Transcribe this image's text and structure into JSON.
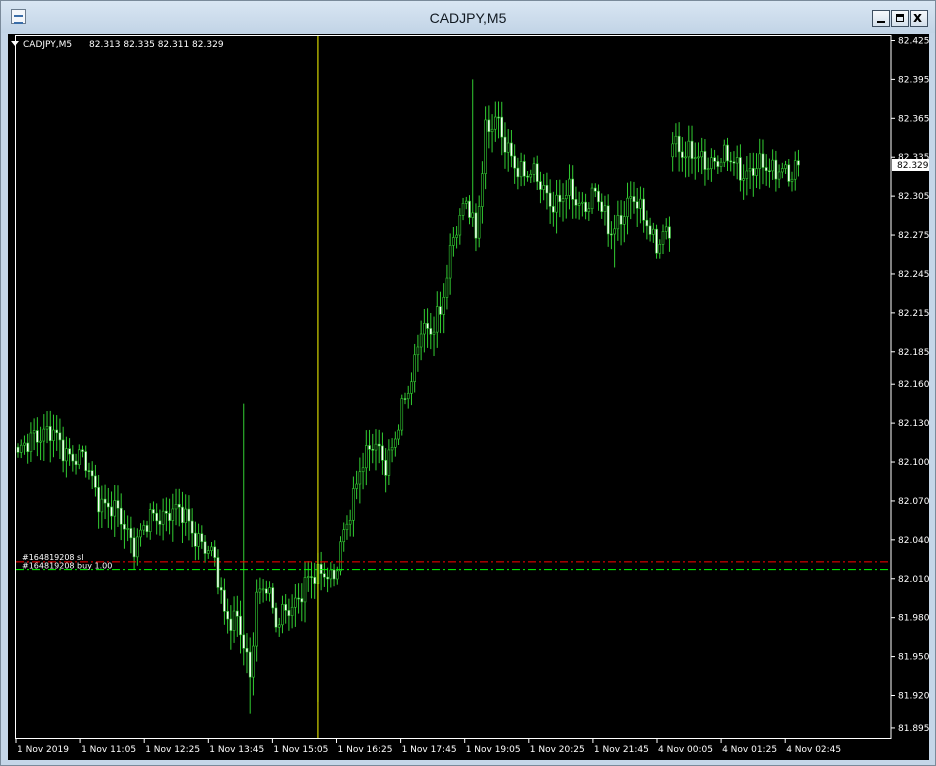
{
  "window": {
    "title": "CADJPY,M5",
    "minimize_label": "_",
    "maximize_label": "□",
    "close_label": "x"
  },
  "chart_header": {
    "symbol_timeframe": "CADJPY,M5",
    "ohlc": "82.313 82.335 82.311 82.329"
  },
  "colors": {
    "background": "#000000",
    "candle": "#32cd32",
    "candle_up_body": "#000000",
    "candle_down_body": "#ffffff",
    "axis_text": "#ffffff",
    "crosshair": "#ffff00",
    "entry_line": "#ff0000",
    "sl_line": "#00ff00"
  },
  "orders": {
    "entry_label": "#164819208 sl",
    "order_label": "#164819208 buy 1.00"
  },
  "chart_data": {
    "type": "candlestick",
    "title": "",
    "symbol": "CADJPY",
    "timeframe": "M5",
    "xlabel": "",
    "ylabel": "",
    "ylim": [
      81.888,
      82.43
    ],
    "yticks": [
      "82.425",
      "82.395",
      "82.365",
      "82.335",
      "82.305",
      "82.275",
      "82.245",
      "82.215",
      "82.185",
      "82.160",
      "82.130",
      "82.100",
      "82.070",
      "82.040",
      "82.010",
      "81.980",
      "81.950",
      "81.920",
      "81.895"
    ],
    "xticks": [
      "1 Nov 2019",
      "1 Nov 11:05",
      "1 Nov 12:25",
      "1 Nov 13:45",
      "1 Nov 15:05",
      "1 Nov 16:25",
      "1 Nov 17:45",
      "1 Nov 19:05",
      "1 Nov 20:25",
      "1 Nov 21:45",
      "4 Nov 00:05",
      "4 Nov 01:25",
      "4 Nov 02:45"
    ],
    "current_price": "82.329",
    "horizontal_levels": [
      {
        "name": "#164819208 sl",
        "price": 82.023,
        "style": "dash-dot",
        "color": "#ff0000"
      },
      {
        "name": "#164819208 buy 1.00",
        "price": 82.017,
        "style": "dash-dot",
        "color": "#00ff00"
      }
    ],
    "vertical_marker_index": 93,
    "grid": false,
    "anchors_close": [
      [
        0,
        82.1
      ],
      [
        5,
        82.125
      ],
      [
        10,
        82.12
      ],
      [
        15,
        82.11
      ],
      [
        20,
        82.1
      ],
      [
        25,
        82.075
      ],
      [
        30,
        82.06
      ],
      [
        36,
        82.04
      ],
      [
        42,
        82.055
      ],
      [
        47,
        82.065
      ],
      [
        52,
        82.055
      ],
      [
        57,
        82.04
      ],
      [
        61,
        82.02
      ],
      [
        64,
        81.985
      ],
      [
        68,
        81.98
      ],
      [
        72,
        81.93
      ],
      [
        74,
        82.0
      ],
      [
        77,
        82.01
      ],
      [
        80,
        81.97
      ],
      [
        84,
        81.99
      ],
      [
        88,
        82.0
      ],
      [
        92,
        82.01
      ],
      [
        95,
        82.02
      ],
      [
        98,
        82.01
      ],
      [
        102,
        82.05
      ],
      [
        106,
        82.1
      ],
      [
        110,
        82.11
      ],
      [
        114,
        82.1
      ],
      [
        118,
        82.13
      ],
      [
        122,
        82.16
      ],
      [
        125,
        82.21
      ],
      [
        128,
        82.2
      ],
      [
        131,
        82.21
      ],
      [
        135,
        82.28
      ],
      [
        139,
        82.3
      ],
      [
        142,
        82.27
      ],
      [
        145,
        82.36
      ],
      [
        148,
        82.365
      ],
      [
        151,
        82.34
      ],
      [
        155,
        82.33
      ],
      [
        159,
        82.32
      ],
      [
        163,
        82.31
      ],
      [
        167,
        82.3
      ],
      [
        171,
        82.305
      ],
      [
        175,
        82.3
      ],
      [
        179,
        82.305
      ],
      [
        183,
        82.28
      ],
      [
        187,
        82.29
      ],
      [
        191,
        82.3
      ],
      [
        195,
        82.29
      ],
      [
        198,
        82.265
      ],
      [
        202,
        82.275
      ],
      [
        203,
        82.35
      ],
      [
        207,
        82.34
      ],
      [
        211,
        82.33
      ],
      [
        216,
        82.335
      ],
      [
        221,
        82.33
      ],
      [
        226,
        82.325
      ],
      [
        231,
        82.325
      ],
      [
        236,
        82.33
      ],
      [
        240,
        82.315
      ],
      [
        242,
        82.329
      ]
    ],
    "gaps_after_index": [
      202
    ]
  }
}
